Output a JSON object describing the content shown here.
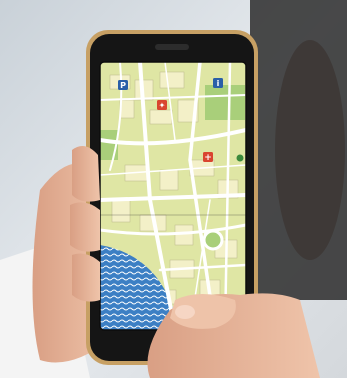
{
  "scene": {
    "description_colors": {
      "background_top": "#cfd6dc",
      "background_bottom": "#e9edf0",
      "phone_frame": "#1c1c1c",
      "phone_rim": "#c7a064",
      "map_land": "#dfe6a4",
      "map_block": "#f3f0c8",
      "map_park": "#a9cf7a",
      "map_road": "#ffffff",
      "map_water": "#3c7fc4",
      "skin": "#e8b79c",
      "sleeve": "#f5f5f5"
    }
  },
  "map_markers": [
    {
      "icon": "parking-icon",
      "color": "#2a5fa8",
      "glyph": "P"
    },
    {
      "icon": "info-icon",
      "color": "#2a5fa8",
      "glyph": "i"
    },
    {
      "icon": "maple-leaf-icon",
      "color": "#d9452f",
      "glyph": "✦"
    },
    {
      "icon": "hospital-cross-icon",
      "color": "#d9452f",
      "glyph": "+"
    },
    {
      "icon": "tree-icon",
      "color": "#3b8a3b",
      "glyph": "♣"
    }
  ]
}
